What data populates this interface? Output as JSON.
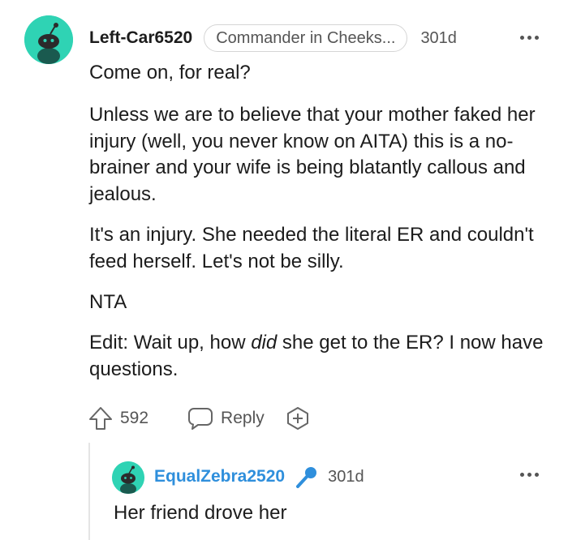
{
  "comment": {
    "username": "Left-Car6520",
    "flair": "Commander in Cheeks...",
    "time": "301d",
    "paragraphs": [
      "Come on, for real?",
      "Unless we are to believe that your mother faked her injury (well, you never know on AITA) this is a no-brainer and your wife is being blatantly callous and jealous.",
      "It's an injury. She needed the literal ER and couldn't feed herself. Let's not be silly.",
      "NTA"
    ],
    "edit": {
      "before": "Edit: Wait up, how ",
      "emphasis": "did",
      "after": " she get to the ER? I now have questions."
    },
    "votes": "592",
    "reply_label": "Reply",
    "avatar_icon": "snoo-avatar-icon",
    "avatar_color": "#2fd3b4"
  },
  "reply": {
    "username": "EqualZebra2520",
    "time": "301d",
    "text": "Her friend drove her",
    "username_color": "#2f8fdc",
    "mic_icon": "microphone-icon"
  },
  "icons": {
    "upvote": "upvote-arrow-icon",
    "reply": "speech-bubble-icon",
    "award": "award-plus-icon",
    "more": "more-options-icon"
  }
}
